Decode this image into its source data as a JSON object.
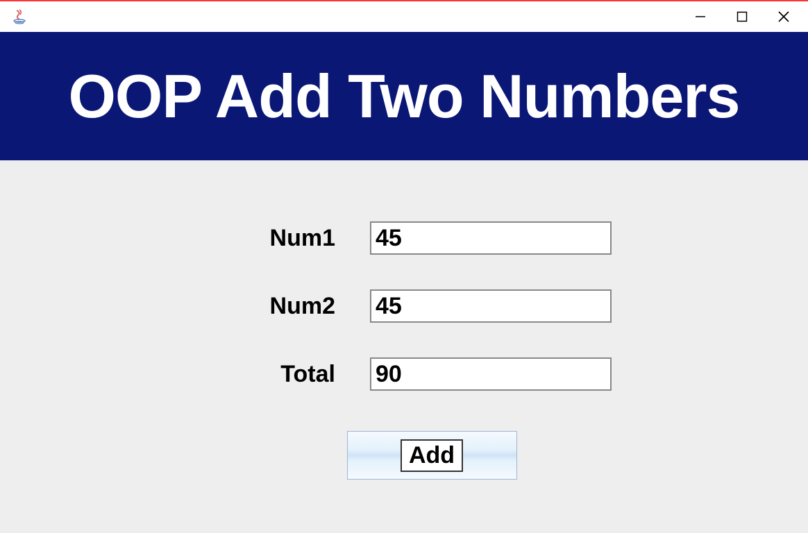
{
  "window": {
    "title": ""
  },
  "header": {
    "title": "OOP Add Two Numbers"
  },
  "form": {
    "num1_label": "Num1",
    "num1_value": "45",
    "num2_label": "Num2",
    "num2_value": "45",
    "total_label": "Total",
    "total_value": "90",
    "add_button_label": "Add"
  },
  "colors": {
    "banner_bg": "#0a1775",
    "content_bg": "#eeeeee"
  }
}
